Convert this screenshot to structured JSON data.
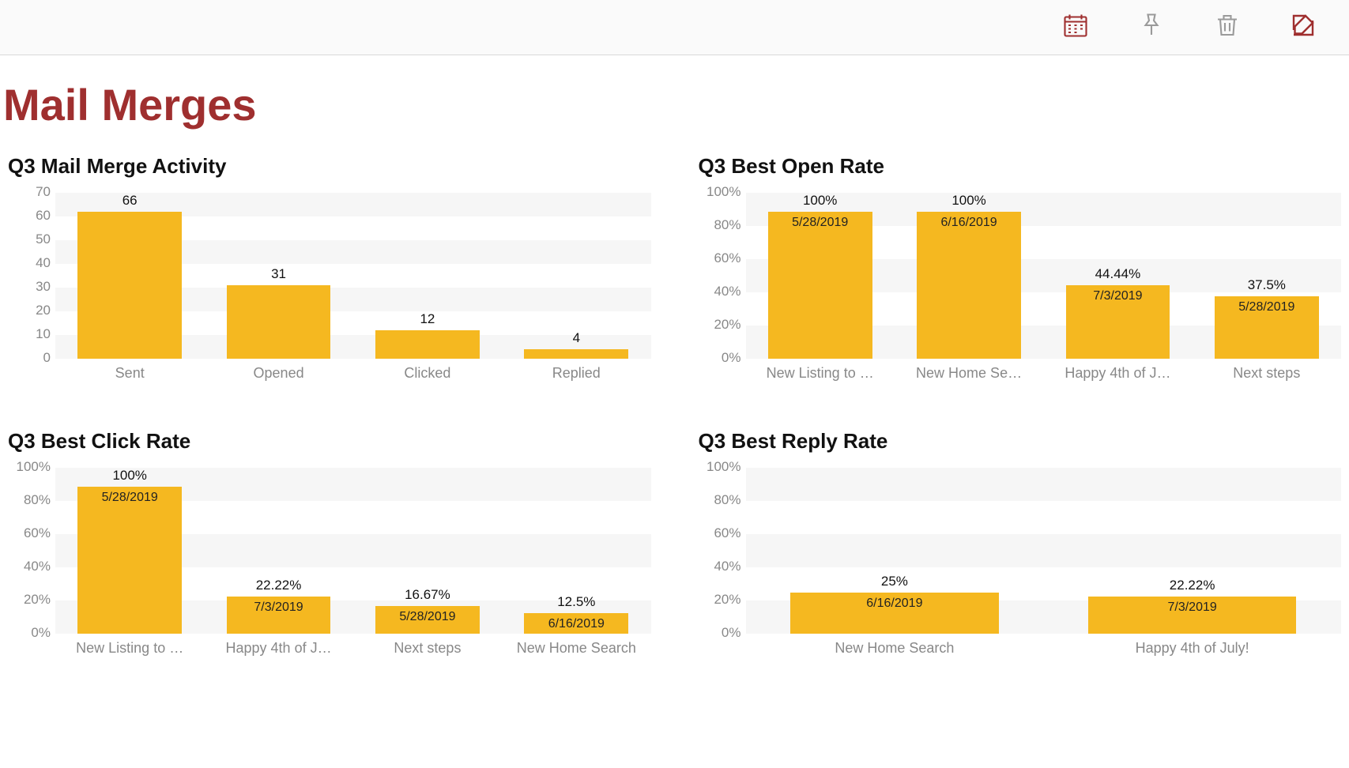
{
  "toolbar": {
    "icons": [
      "calendar-icon",
      "pin-icon",
      "trash-icon",
      "edit-icon"
    ]
  },
  "page_title": "Mail Merges",
  "chart_data": [
    {
      "id": "activity",
      "type": "bar",
      "title": "Q3 Mail Merge Activity",
      "categories": [
        "Sent",
        "Opened",
        "Clicked",
        "Replied"
      ],
      "values": [
        66,
        31,
        12,
        4
      ],
      "value_labels": [
        "66",
        "31",
        "12",
        "4"
      ],
      "inner_labels": [
        "",
        "",
        "",
        ""
      ],
      "ylim": [
        0,
        70
      ],
      "yticks": [
        70,
        60,
        50,
        40,
        30,
        20,
        10,
        0
      ],
      "ytick_labels": [
        "70",
        "60",
        "50",
        "40",
        "30",
        "20",
        "10",
        "0"
      ]
    },
    {
      "id": "open_rate",
      "type": "bar",
      "title": "Q3 Best Open Rate",
      "categories": [
        "New Listing to …",
        "New Home Se…",
        "Happy 4th of J…",
        "Next steps"
      ],
      "values": [
        100,
        100,
        44.44,
        37.5
      ],
      "value_labels": [
        "100%",
        "100%",
        "44.44%",
        "37.5%"
      ],
      "inner_labels": [
        "5/28/2019",
        "6/16/2019",
        "7/3/2019",
        "5/28/2019"
      ],
      "ylim": [
        0,
        100
      ],
      "yticks": [
        100,
        80,
        60,
        40,
        20,
        0
      ],
      "ytick_labels": [
        "100%",
        "80%",
        "60%",
        "40%",
        "20%",
        "0%"
      ]
    },
    {
      "id": "click_rate",
      "type": "bar",
      "title": "Q3 Best Click Rate",
      "categories": [
        "New Listing to …",
        "Happy 4th of J…",
        "Next steps",
        "New Home Search"
      ],
      "values": [
        100,
        22.22,
        16.67,
        12.5
      ],
      "value_labels": [
        "100%",
        "22.22%",
        "16.67%",
        "12.5%"
      ],
      "inner_labels": [
        "5/28/2019",
        "7/3/2019",
        "5/28/2019",
        "6/16/2019"
      ],
      "ylim": [
        0,
        100
      ],
      "yticks": [
        100,
        80,
        60,
        40,
        20,
        0
      ],
      "ytick_labels": [
        "100%",
        "80%",
        "60%",
        "40%",
        "20%",
        "0%"
      ]
    },
    {
      "id": "reply_rate",
      "type": "bar",
      "title": "Q3 Best Reply Rate",
      "categories": [
        "New Home Search",
        "Happy 4th of July!"
      ],
      "values": [
        25,
        22.22
      ],
      "value_labels": [
        "25%",
        "22.22%"
      ],
      "inner_labels": [
        "6/16/2019",
        "7/3/2019"
      ],
      "ylim": [
        0,
        100
      ],
      "yticks": [
        100,
        80,
        60,
        40,
        20,
        0
      ],
      "ytick_labels": [
        "100%",
        "80%",
        "60%",
        "40%",
        "20%",
        "0%"
      ]
    }
  ],
  "colors": {
    "accent": "#9f2f2f",
    "bar": "#f5b820",
    "muted": "#888"
  }
}
